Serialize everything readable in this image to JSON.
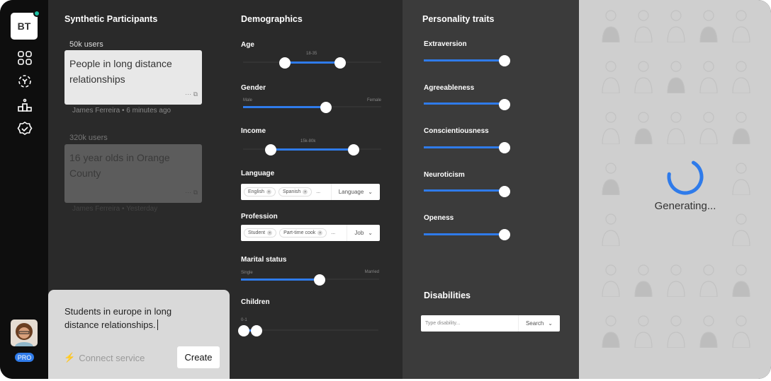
{
  "sidebar": {
    "logo": "BT",
    "badge": "PRO",
    "nav": [
      "grid-icon",
      "persona-icon",
      "ranking-icon",
      "verified-icon"
    ]
  },
  "participants": {
    "title": "Synthetic Participants",
    "cards": [
      {
        "users": "50k users",
        "text": "People in long distance relationships",
        "meta": "James Ferreira • 6 minutes ago"
      },
      {
        "users": "320k users",
        "text": "16 year olds in Orange County",
        "meta": "James Ferreira • Yesterday"
      }
    ]
  },
  "compose": {
    "text": "Students in europe in long distance relationships.",
    "connect": "Connect service",
    "create": "Create"
  },
  "demographics": {
    "title": "Demographics",
    "age": {
      "label": "Age",
      "range": "18-35",
      "low": 0.3,
      "high": 0.7
    },
    "gender": {
      "label": "Gender",
      "left": "Male",
      "right": "Female",
      "value": 0.6
    },
    "income": {
      "label": "Income",
      "range": "15k-80k",
      "low": 0.2,
      "high": 0.8
    },
    "language": {
      "label": "Language",
      "chips": [
        "English",
        "Spanish"
      ],
      "more": "...",
      "dropdown": "Language"
    },
    "profession": {
      "label": "Profession",
      "chips": [
        "Student",
        "Part-time cook"
      ],
      "more": "...",
      "dropdown": "Job"
    },
    "marital": {
      "label": "Marital status",
      "left": "Single",
      "right": "Married",
      "value": 0.57
    },
    "children": {
      "label": "Children",
      "range": "0-1",
      "low": 0.0,
      "high": 0.1
    }
  },
  "personality": {
    "title": "Personality traits",
    "traits": [
      {
        "label": "Extraversion",
        "value": 0.95
      },
      {
        "label": "Agreeableness",
        "value": 0.95
      },
      {
        "label": "Conscientiousness",
        "value": 0.95
      },
      {
        "label": "Neuroticism",
        "value": 0.95
      },
      {
        "label": "Openess",
        "value": 0.95
      }
    ]
  },
  "disabilities": {
    "title": "Disabilities",
    "placeholder": "Type disability...",
    "button": "Search"
  },
  "status": {
    "text": "Generating...",
    "accent": "#2f7bea"
  }
}
